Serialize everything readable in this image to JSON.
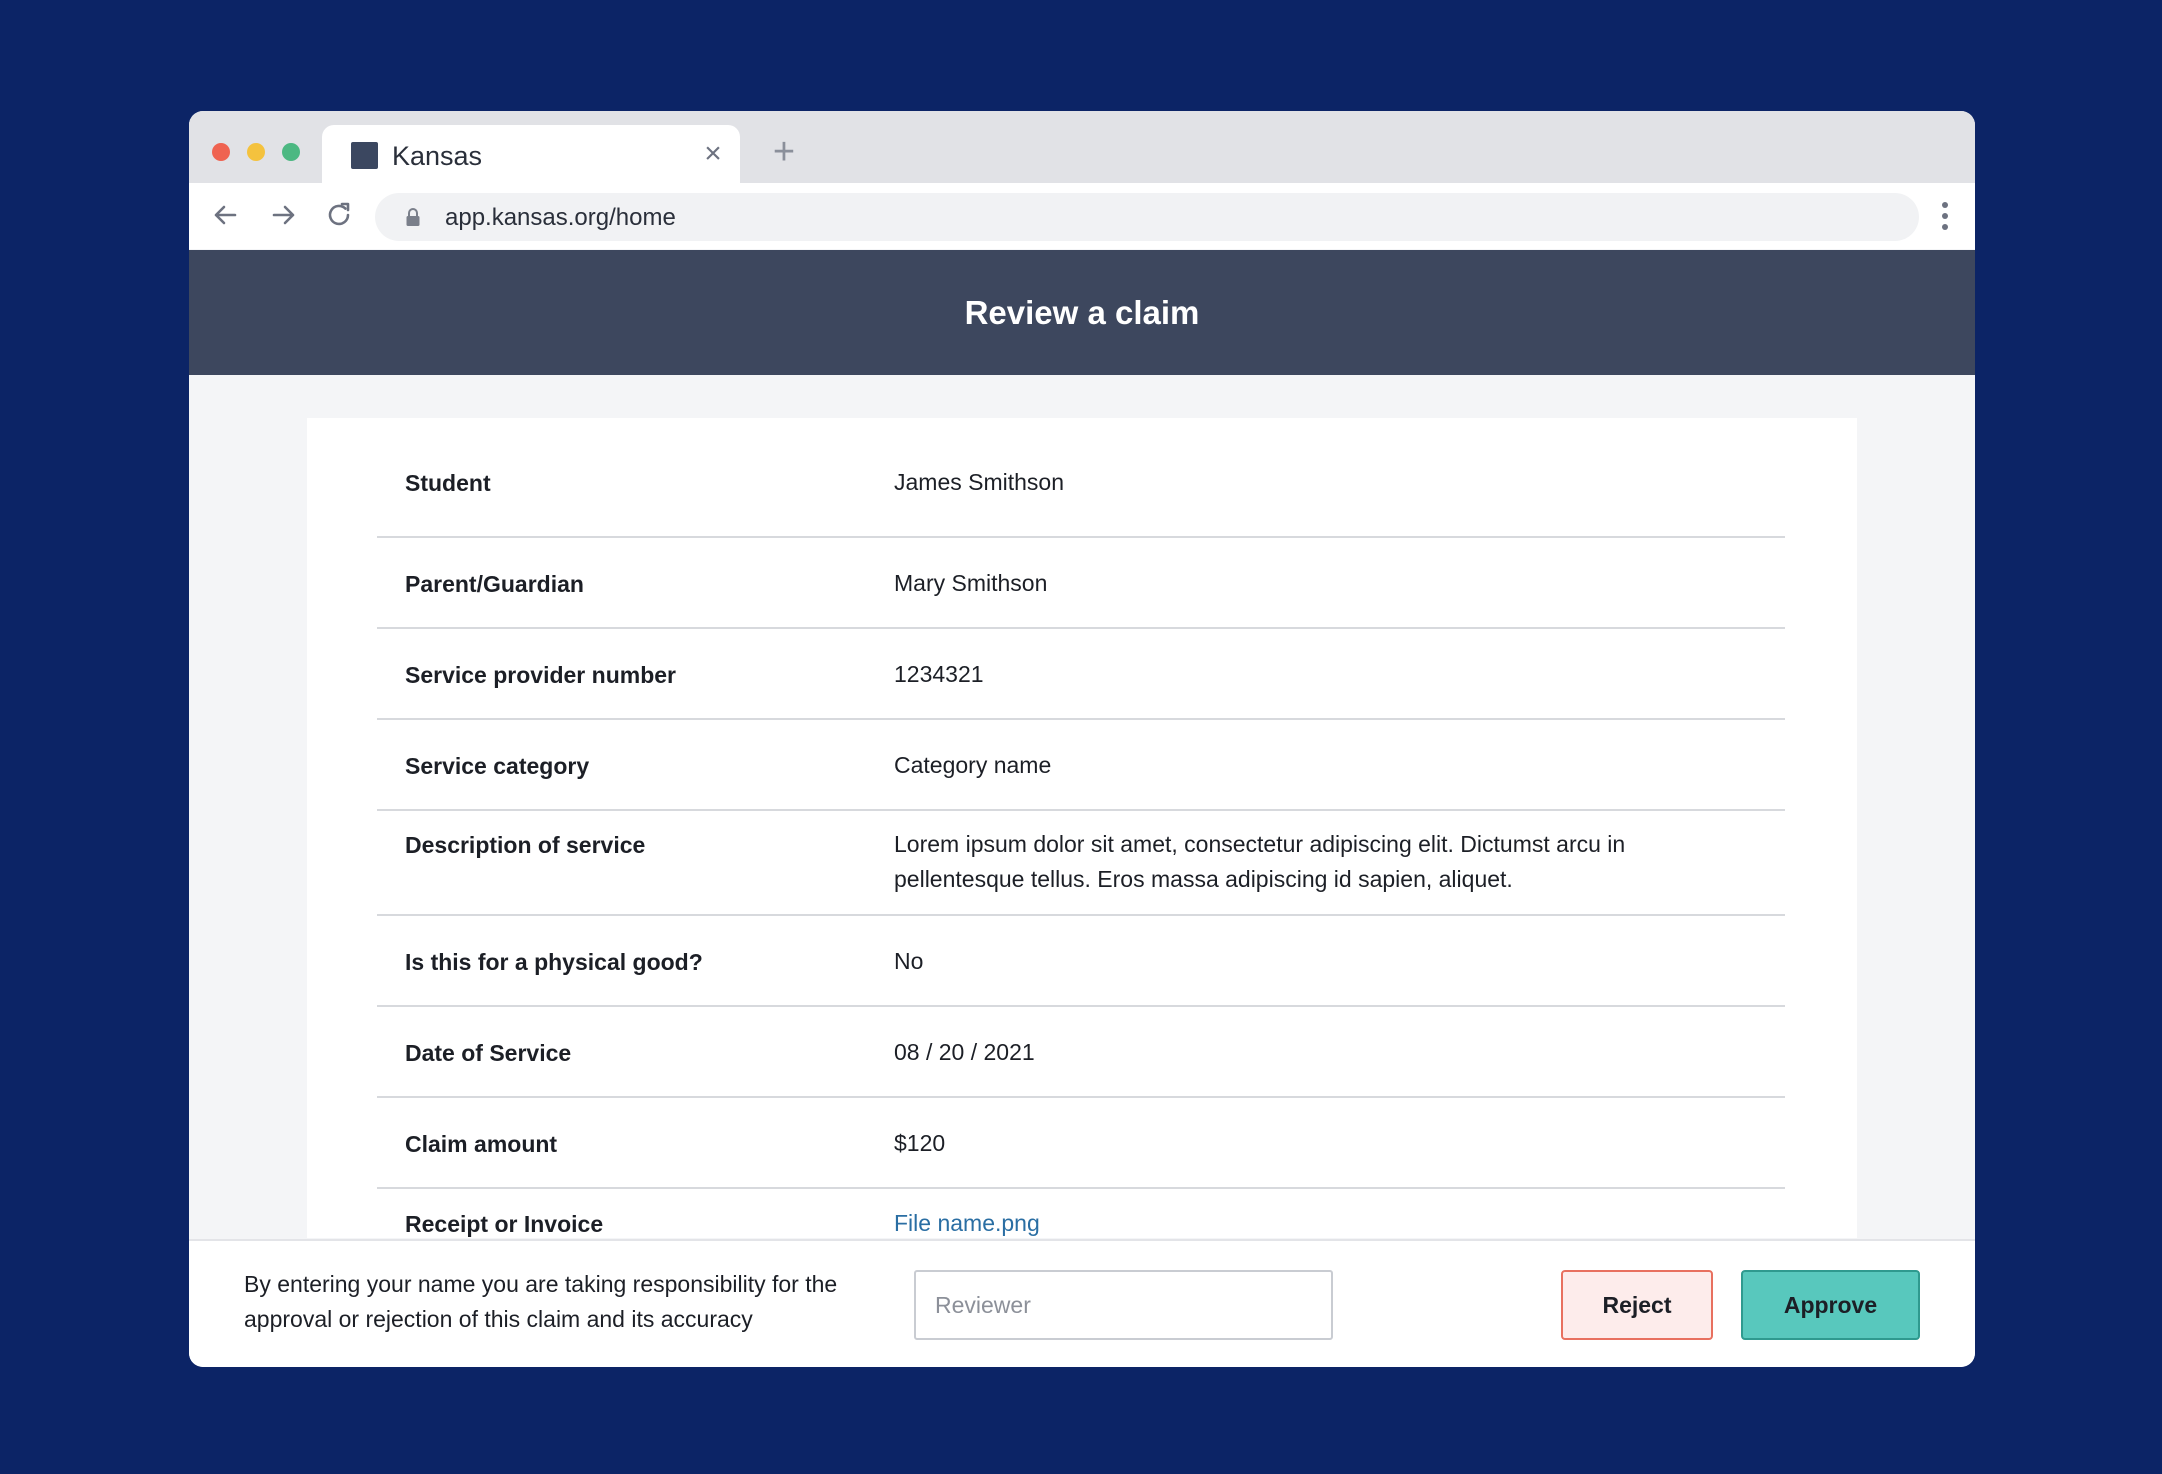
{
  "window": {
    "traffic_lights": {
      "red": "#ef6351",
      "yellow": "#f4c23e",
      "green": "#4cb882"
    },
    "tab": {
      "title": "Kansas",
      "close_glyph": "×"
    },
    "new_tab_glyph": "+",
    "address": {
      "url": "app.kansas.org/home"
    }
  },
  "header": {
    "title": "Review a claim"
  },
  "claim": {
    "rows": [
      {
        "label": "Student",
        "value": "James Smithson"
      },
      {
        "label": "Parent/Guardian",
        "value": "Mary Smithson"
      },
      {
        "label": "Service provider number",
        "value": "1234321"
      },
      {
        "label": "Service category",
        "value": "Category name"
      },
      {
        "label": "Description of service",
        "value": "Lorem ipsum dolor sit amet, consectetur adipiscing elit. Dictumst arcu in pellentesque tellus. Eros massa adipiscing id sapien, aliquet."
      },
      {
        "label": "Is this for a physical good?",
        "value": "No"
      },
      {
        "label": "Date of Service",
        "value": "08 / 20 / 2021"
      },
      {
        "label": "Claim amount",
        "value": "$120"
      },
      {
        "label": "Receipt or Invoice",
        "value": "File name.png"
      }
    ]
  },
  "footer": {
    "disclaimer": "By entering your name you are taking responsibility for the approval or rejection of this claim and its accuracy",
    "reviewer_placeholder": "Reviewer",
    "reject_label": "Reject",
    "approve_label": "Approve"
  },
  "icons": [
    "back-arrow-icon",
    "forward-arrow-icon",
    "reload-icon",
    "lock-icon",
    "more-vertical-icon",
    "favicon-icon"
  ],
  "colors": {
    "page_bg": "#0c2466",
    "header_bg": "#3d475e",
    "link": "#2a6ea3",
    "approve": "#58c8bd",
    "reject_border": "#e8705f"
  }
}
